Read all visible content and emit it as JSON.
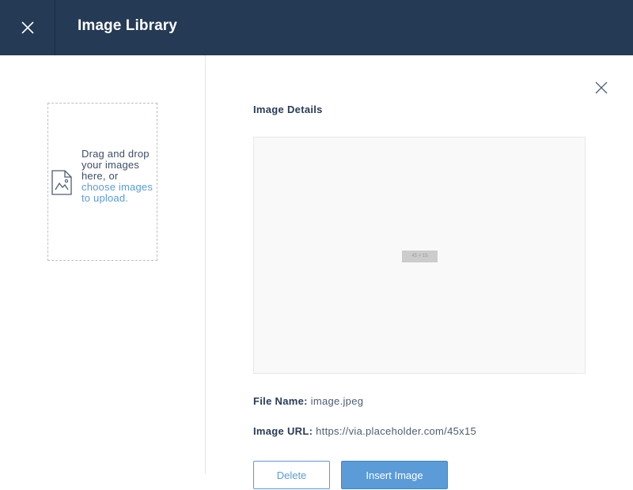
{
  "header": {
    "title": "Image Library",
    "close_icon": "close-icon"
  },
  "upload": {
    "text": "Drag and drop your images here, or",
    "link_text": "choose images to upload.",
    "icon": "image-file-icon"
  },
  "details": {
    "title": "Image Details",
    "preview_placeholder": "45 × 15",
    "file_name_label": "File Name:",
    "file_name_value": "image.jpeg",
    "image_url_label": "Image URL:",
    "image_url_value": "https://via.placeholder.com/45x15",
    "close_icon": "close-icon"
  },
  "actions": {
    "delete_label": "Delete",
    "insert_label": "Insert Image"
  },
  "colors": {
    "header_bg": "#243a55",
    "accent": "#5a9bd8",
    "text_dark": "#2a3c55"
  }
}
